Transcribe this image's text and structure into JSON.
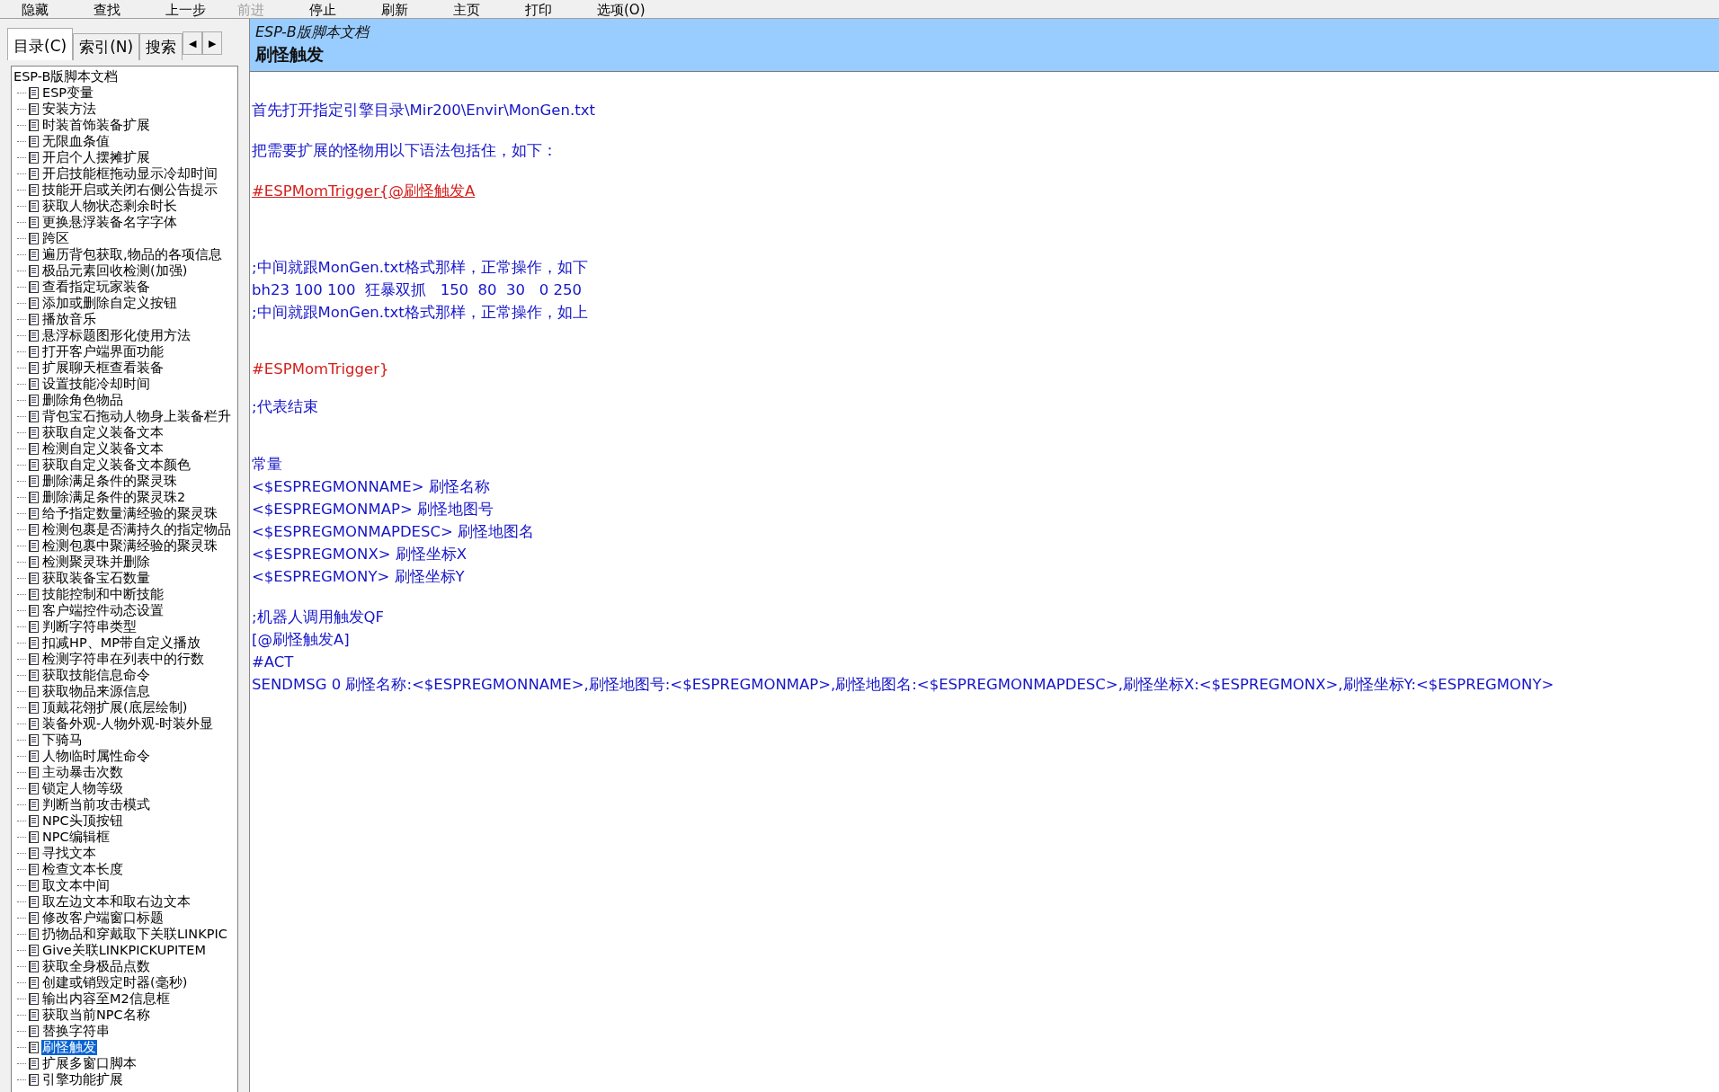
{
  "toolbar": [
    {
      "label": "隐藏",
      "disabled": false
    },
    {
      "label": "查找",
      "disabled": false
    },
    {
      "label": "上一步",
      "disabled": false
    },
    {
      "label": "前进",
      "disabled": true
    },
    {
      "label": "停止",
      "disabled": false
    },
    {
      "label": "刷新",
      "disabled": false
    },
    {
      "label": "主页",
      "disabled": false
    },
    {
      "label": "打印",
      "disabled": false
    },
    {
      "label": "选项(O)",
      "disabled": false
    }
  ],
  "tabs": [
    {
      "label": "目录(C)",
      "selected": true
    },
    {
      "label": "索引(N)",
      "selected": false
    },
    {
      "label": "搜索",
      "selected": false
    }
  ],
  "tab_scroll": {
    "left": "◀",
    "right": "▶"
  },
  "tree": [
    {
      "label": "ESP-B版脚本文档",
      "selected": false,
      "children": [
        {
          "label": "ESP变量",
          "selected": false
        },
        {
          "label": "安装方法",
          "selected": false
        },
        {
          "label": "时装首饰装备扩展",
          "selected": false
        },
        {
          "label": "无限血条值",
          "selected": false
        },
        {
          "label": "开启个人摆摊扩展",
          "selected": false
        },
        {
          "label": "开启技能框拖动显示冷却时间",
          "selected": false
        },
        {
          "label": "技能开启或关闭右侧公告提示",
          "selected": false
        },
        {
          "label": "获取人物状态剩余时长",
          "selected": false
        },
        {
          "label": "更换悬浮装备名字字体",
          "selected": false
        },
        {
          "label": "跨区",
          "selected": false
        },
        {
          "label": "遍历背包获取,物品的各项信息",
          "selected": false
        },
        {
          "label": "极品元素回收检测(加强)",
          "selected": false
        },
        {
          "label": "查看指定玩家装备",
          "selected": false
        },
        {
          "label": "添加或删除自定义按钮",
          "selected": false
        },
        {
          "label": "播放音乐",
          "selected": false
        },
        {
          "label": "悬浮标题图形化使用方法",
          "selected": false
        },
        {
          "label": "打开客户端界面功能",
          "selected": false
        },
        {
          "label": "扩展聊天框查看装备",
          "selected": false
        },
        {
          "label": "设置技能冷却时间",
          "selected": false
        },
        {
          "label": "删除角色物品",
          "selected": false
        },
        {
          "label": "背包宝石拖动人物身上装备栏升",
          "selected": false
        },
        {
          "label": "获取自定义装备文本",
          "selected": false
        },
        {
          "label": "检测自定义装备文本",
          "selected": false
        },
        {
          "label": "获取自定义装备文本颜色",
          "selected": false
        },
        {
          "label": "删除满足条件的聚灵珠",
          "selected": false
        },
        {
          "label": "删除满足条件的聚灵珠2",
          "selected": false
        },
        {
          "label": "给予指定数量满经验的聚灵珠",
          "selected": false
        },
        {
          "label": "检测包裹是否满持久的指定物品",
          "selected": false
        },
        {
          "label": "检测包裹中聚满经验的聚灵珠",
          "selected": false
        },
        {
          "label": "检测聚灵珠并删除",
          "selected": false
        },
        {
          "label": "获取装备宝石数量",
          "selected": false
        },
        {
          "label": "技能控制和中断技能",
          "selected": false
        },
        {
          "label": "客户端控件动态设置",
          "selected": false
        },
        {
          "label": "判断字符串类型",
          "selected": false
        },
        {
          "label": "扣减HP、MP带自定义播放",
          "selected": false
        },
        {
          "label": "检测字符串在列表中的行数",
          "selected": false
        },
        {
          "label": "获取技能信息命令",
          "selected": false
        },
        {
          "label": "获取物品来源信息",
          "selected": false
        },
        {
          "label": "顶戴花翎扩展(底层绘制)",
          "selected": false
        },
        {
          "label": "装备外观-人物外观-时装外显",
          "selected": false
        },
        {
          "label": "下骑马",
          "selected": false
        },
        {
          "label": "人物临时属性命令",
          "selected": false
        },
        {
          "label": "主动暴击次数",
          "selected": false
        },
        {
          "label": "锁定人物等级",
          "selected": false
        },
        {
          "label": "判断当前攻击模式",
          "selected": false
        },
        {
          "label": "NPC头顶按钮",
          "selected": false
        },
        {
          "label": "NPC编辑框",
          "selected": false
        },
        {
          "label": "寻找文本",
          "selected": false
        },
        {
          "label": "检查文本长度",
          "selected": false
        },
        {
          "label": "取文本中间",
          "selected": false
        },
        {
          "label": "取左边文本和取右边文本",
          "selected": false
        },
        {
          "label": "修改客户端窗口标题",
          "selected": false
        },
        {
          "label": "扔物品和穿戴取下关联LINKPIC",
          "selected": false
        },
        {
          "label": "Give关联LINKPICKUPITEM",
          "selected": false
        },
        {
          "label": "获取全身极品点数",
          "selected": false
        },
        {
          "label": "创建或销毁定时器(毫秒)",
          "selected": false
        },
        {
          "label": "输出内容至M2信息框",
          "selected": false
        },
        {
          "label": "获取当前NPC名称",
          "selected": false
        },
        {
          "label": "替换字符串",
          "selected": false
        },
        {
          "label": "刷怪触发",
          "selected": true
        },
        {
          "label": "扩展多窗口脚本",
          "selected": false
        },
        {
          "label": "引擎功能扩展",
          "selected": false
        }
      ]
    }
  ],
  "header": {
    "doc_title": "ESP-B版脚本文档",
    "topic": "刷怪触发"
  },
  "content": [
    [
      {
        "kind": "text",
        "text": "首先打开指定引擎目录\\Mir200\\Envir\\MonGen.txt"
      }
    ],
    [
      {
        "kind": "text",
        "text": "把需要扩展的怪物用以下语法包括住，如下："
      }
    ],
    [
      {
        "kind": "link",
        "text": "#ESPMomTrigger{@刷怪触发A"
      }
    ],
    [
      {
        "kind": "text",
        "text": ";中间就跟MonGen.txt格式那样，正常操作，如下"
      },
      {
        "kind": "text",
        "text": "bh23 100 100  狂暴双抓   150  80  30   0 250"
      },
      {
        "kind": "text",
        "text": ";中间就跟MonGen.txt格式那样，正常操作，如上"
      }
    ],
    [
      {
        "kind": "marker",
        "text": "#ESPMomTrigger}"
      }
    ],
    [
      {
        "kind": "text",
        "text": ";代表结束"
      }
    ],
    [
      {
        "kind": "text",
        "text": "常量"
      },
      {
        "kind": "text",
        "text": "<$ESPREGMONNAME> 刷怪名称"
      },
      {
        "kind": "text",
        "text": "<$ESPREGMONMAP> 刷怪地图号"
      },
      {
        "kind": "text",
        "text": "<$ESPREGMONMAPDESC> 刷怪地图名"
      },
      {
        "kind": "text",
        "text": "<$ESPREGMONX> 刷怪坐标X"
      },
      {
        "kind": "text",
        "text": "<$ESPREGMONY> 刷怪坐标Y"
      }
    ],
    [
      {
        "kind": "text",
        "text": ";机器人调用触发QF"
      },
      {
        "kind": "text",
        "text": "[@刷怪触发A]"
      },
      {
        "kind": "text",
        "text": "#ACT"
      },
      {
        "kind": "text",
        "text": "SENDMSG 0 刷怪名称:<$ESPREGMONNAME>,刷怪地图号:<$ESPREGMONMAP>,刷怪地图名:<$ESPREGMONMAPDESC>,刷怪坐标X:<$ESPREGMONX>,刷怪坐标Y:<$ESPREGMONY>"
      }
    ]
  ]
}
